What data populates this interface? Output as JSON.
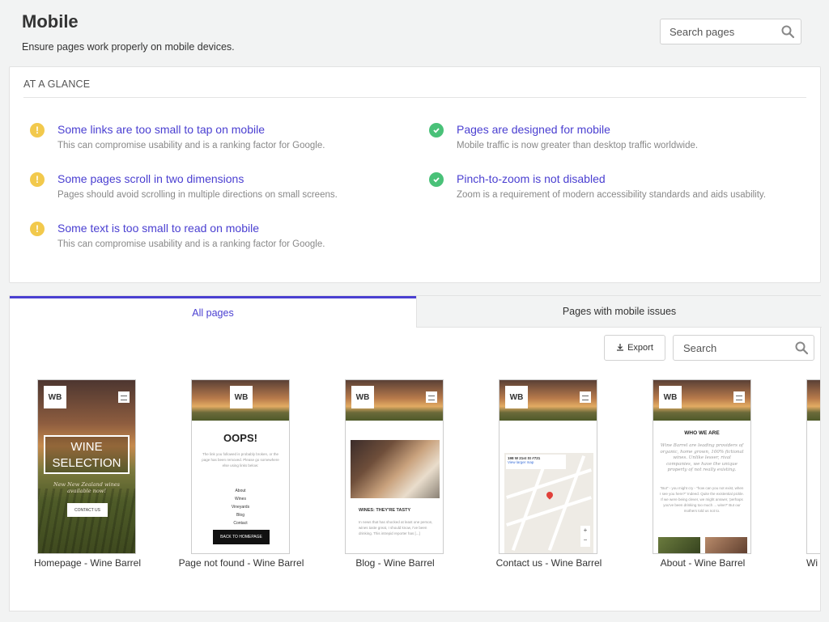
{
  "header": {
    "title": "Mobile",
    "subtitle": "Ensure pages work properly on mobile devices.",
    "search_placeholder": "Search pages"
  },
  "glance": {
    "title": "AT A GLANCE",
    "items": [
      {
        "status": "warning",
        "title": "Some links are too small to tap on mobile",
        "desc": "This can compromise usability and is a ranking factor for Google."
      },
      {
        "status": "warning",
        "title": "Some pages scroll in two dimensions",
        "desc": "Pages should avoid scrolling in multiple directions on small screens."
      },
      {
        "status": "warning",
        "title": "Some text is too small to read on mobile",
        "desc": "This can compromise usability and is a ranking factor for Google."
      },
      {
        "status": "ok",
        "title": "Pages are designed for mobile",
        "desc": "Mobile traffic is now greater than desktop traffic worldwide."
      },
      {
        "status": "ok",
        "title": "Pinch-to-zoom is not disabled",
        "desc": "Zoom is a requirement of modern accessibility standards and aids usability."
      }
    ]
  },
  "tabs": [
    {
      "label": "All pages",
      "active": true
    },
    {
      "label": "Pages with mobile issues",
      "active": false
    }
  ],
  "toolbar": {
    "export_label": "Export",
    "search_placeholder": "Search"
  },
  "pages": [
    {
      "caption": "Homepage - Wine Barrel",
      "logo": "WB",
      "hero_title": "WINE SELECTION",
      "hero_tagline": "New New Zealand wines available now!",
      "hero_button": "CONTACT US"
    },
    {
      "caption": "Page not found - Wine Barrel",
      "logo": "WB",
      "heading": "OOPS!",
      "text": "The link you followed is probably broken, or the page has been removed. Please go somewhere else using links below:",
      "links": [
        "About",
        "Wines",
        "Vineyards",
        "Blog",
        "Contact"
      ],
      "button": "BACK TO HOMEPAGE"
    },
    {
      "caption": "Blog - Wine Barrel",
      "logo": "WB",
      "post_title": "WINES: THEY'RE TASTY",
      "post_text": "In news that has shocked at least one person, wines taste great, I should know, I've been drinking. This intrepid reporter has [...]"
    },
    {
      "caption": "Contact us - Wine Barrel",
      "logo": "WB",
      "map_address": "198 W 21st St #721",
      "map_link": "View larger map"
    },
    {
      "caption": "About - Wine Barrel",
      "logo": "WB",
      "heading": "WHO WE ARE",
      "intro": "Wine Barrel are leading providers of organic, home grown, 100% fictional wines. Unlike lesser, rival companies, we have the unique property of not really existing.",
      "text": "\"But\" - you might cry - \"how can you not exist, when I see you here?\" Indeed. Quite the existential pickle. If we were being clever, we might answer, 'perhaps you've been drinking too much ... wine?' But our mothers told us not to."
    },
    {
      "caption": "Wi"
    }
  ]
}
